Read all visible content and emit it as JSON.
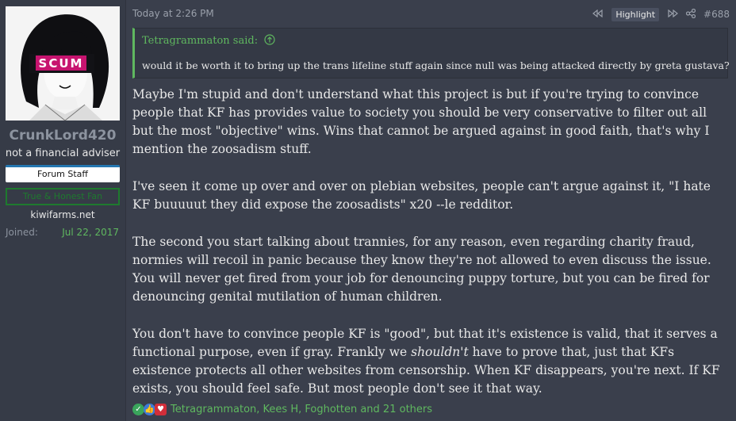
{
  "user": {
    "name": "CrunkLord420",
    "title": "not a financial adviser",
    "banner_staff": "Forum Staff",
    "banner_green": "True & Honest Fan",
    "site": "kiwifarms.net",
    "joined_label": "Joined:",
    "joined_value": "Jul 22, 2017",
    "avatar_text": "SCUM"
  },
  "post": {
    "time": "Today at 2:26 PM",
    "highlight_label": "Highlight",
    "post_number": "#688"
  },
  "quote": {
    "author": "Tetragrammaton said:",
    "text": "would it be worth it to bring up the trans lifeline stuff again since null was being attacked directly by greta gustava?"
  },
  "body": {
    "p1": "Maybe I'm stupid and don't understand what this project is but if you're trying to convince people that KF has provides value to society you should be very conservative to filter out all but the most \"objective\" wins. Wins that cannot be argued against in good faith, that's why I mention the zoosadism stuff.",
    "p2": "I've seen it come up over and over on plebian websites, people can't argue against it, \"I hate KF buuuuut they did expose the zoosadists\" x20 --le redditor.",
    "p3": "The second you start talking about trannies, for any reason, even regarding charity fraud, normies will recoil in panic because they know they're not allowed to even discuss the issue. You will never get fired from your job for denouncing puppy torture, but you can be fired for denouncing genital mutilation of human children.",
    "p4_a": "You don't have to convince people KF is \"good\", but that it's existence is valid, that it serves a functional purpose, even if gray. Frankly we ",
    "p4_em": "shouldn't",
    "p4_b": " have to prove that, just that KFs existence protects all other websites from censorship. When KF disappears, you're next. If KF exists, you should feel safe. But most people don't see it that way."
  },
  "reactions": {
    "users": "Tetragrammaton, Kees H, Foghotten and 21 others",
    "icons": [
      "check-icon",
      "thumbs-up-icon",
      "heart-icon"
    ],
    "colors": {
      "check": "#3aa55c",
      "thumbs": "#3d7bd8",
      "heart": "#d22e3a"
    }
  }
}
